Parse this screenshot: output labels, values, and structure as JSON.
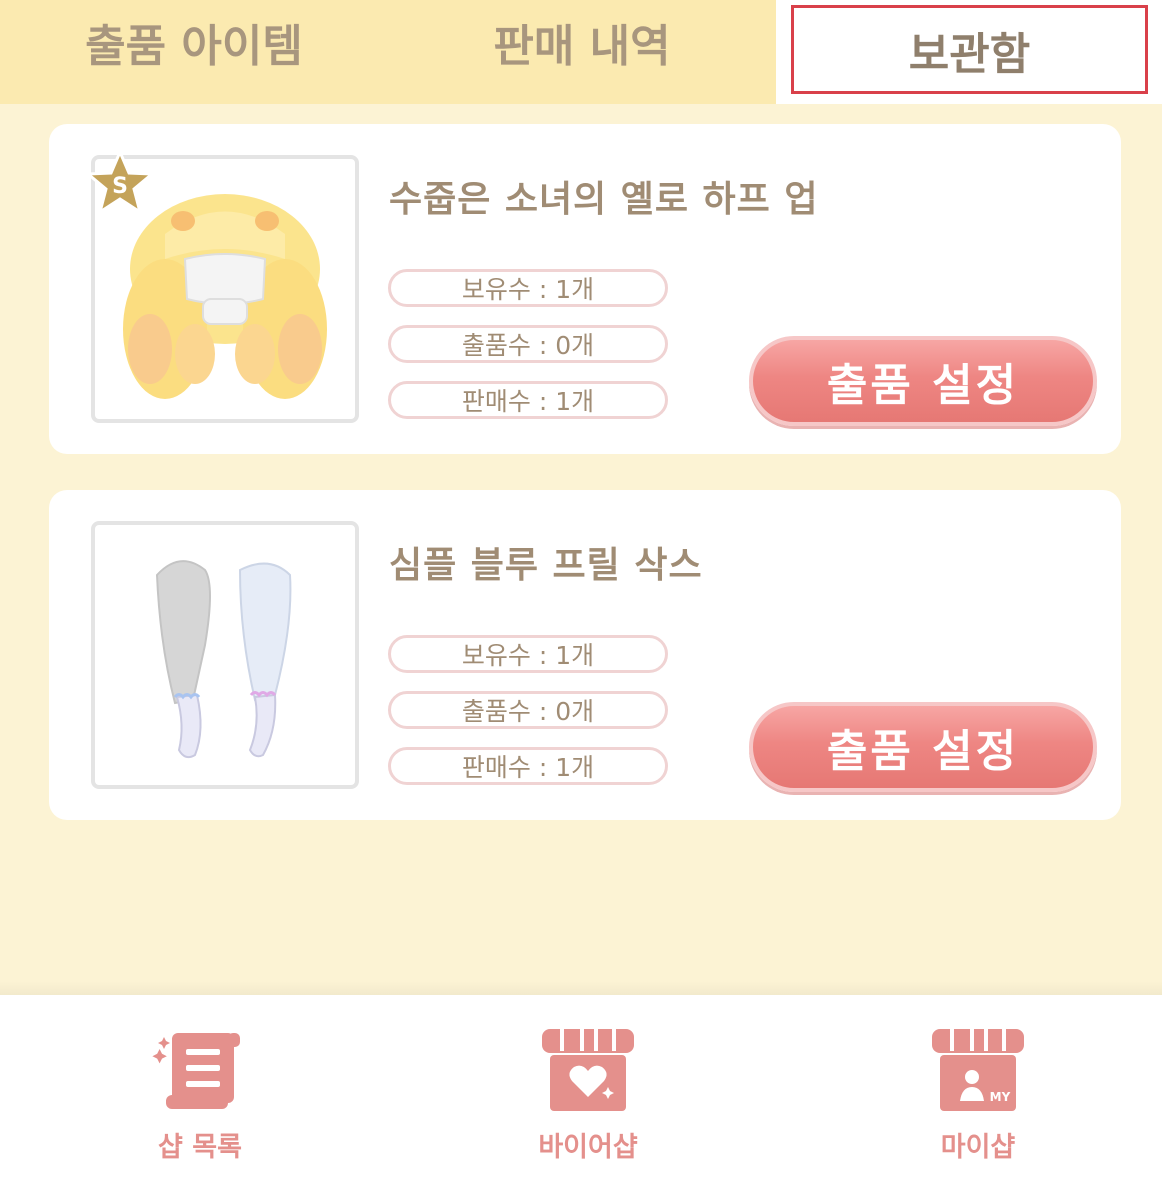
{
  "tabs": {
    "listed_items": "출품 아이템",
    "sales_history": "판매 내역",
    "storage": "보관함"
  },
  "items": [
    {
      "name": "수줍은 소녀의 옐로 하프 업",
      "owned": "보유수 : 1개",
      "listed": "출품수 : 0개",
      "sold": "판매수 : 1개",
      "button": "출품 설정",
      "grade_badge": "S",
      "thumbnail_icon": "yellow-wavy-hair-icon"
    },
    {
      "name": "심플 블루 프릴 삭스",
      "owned": "보유수 : 1개",
      "listed": "출품수 : 0개",
      "sold": "판매수 : 1개",
      "button": "출품 설정",
      "thumbnail_icon": "blue-frill-socks-icon"
    }
  ],
  "bottom_nav": {
    "shop_list": "샵 목록",
    "buyer_shop": "바이어샵",
    "my_shop": "마이샵",
    "my_badge": "MY"
  },
  "colors": {
    "background": "#fcf3d4",
    "tab_inactive": "#fbeab0",
    "highlight_border": "#d9404a",
    "button": "#ee8683",
    "text": "#a08c74",
    "nav": "#e4908c"
  }
}
